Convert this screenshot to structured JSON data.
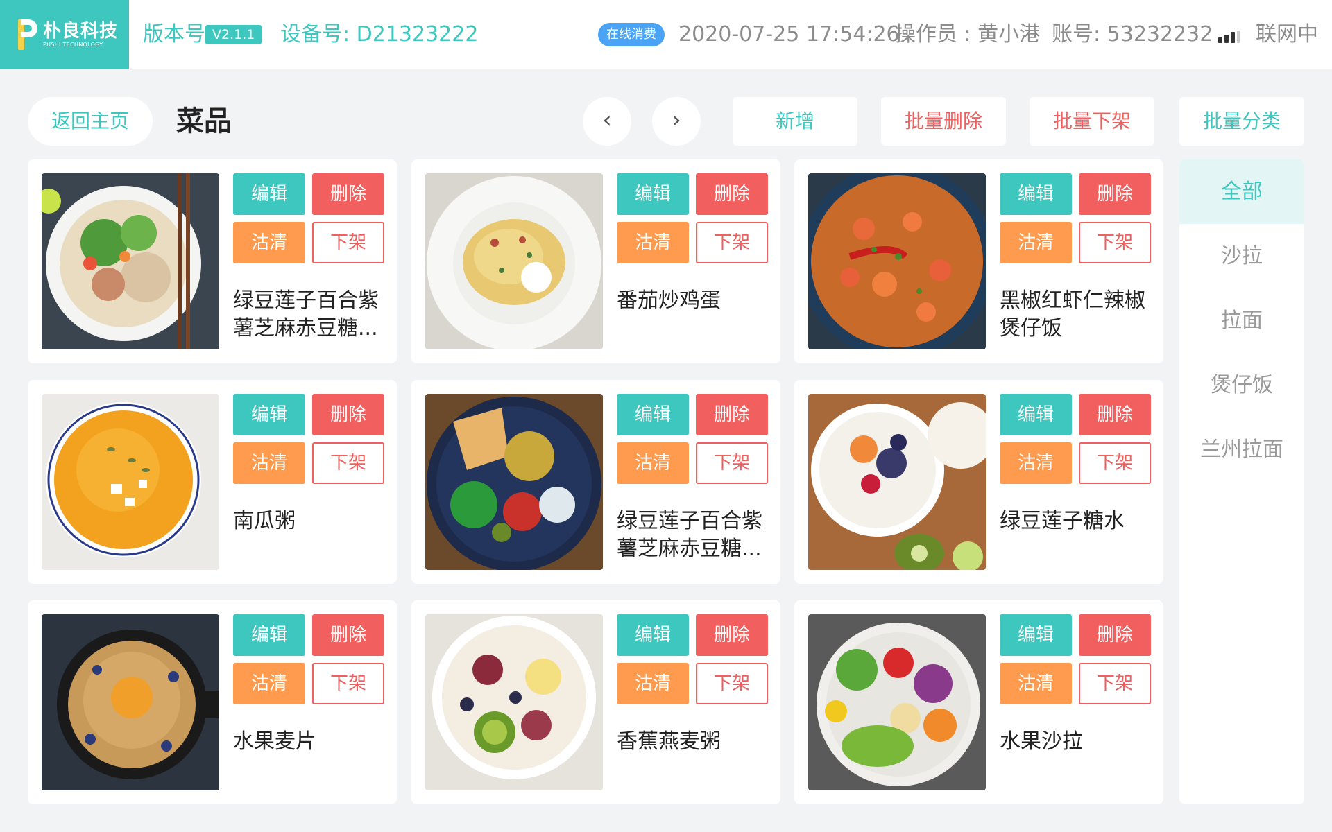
{
  "header": {
    "logo_name": "朴良科技",
    "logo_sub": "PUSHI TECHNOLOGY",
    "version_label": "版本号",
    "version_value": "V2.1.1",
    "device_label": "设备号: D21323222",
    "online_badge": "在线消费",
    "datetime": "2020-07-25 17:54:26",
    "operator": "操作员 : 黄小港",
    "account": "账号: 53232232",
    "network_status": "联网中"
  },
  "toolbar": {
    "back_label": "返回主页",
    "title": "菜品",
    "prev_icon": "‹",
    "next_icon": "›",
    "add_label": "新增",
    "batch_delete_label": "批量删除",
    "batch_offshelf_label": "批量下架",
    "batch_category_label": "批量分类"
  },
  "actions": {
    "edit": "编辑",
    "delete": "删除",
    "clean": "沽清",
    "offshelf": "下架"
  },
  "dishes": [
    {
      "name": "绿豆莲子百合紫薯芝麻赤豆糖...",
      "image": "noodle-salad-bowl"
    },
    {
      "name": "番茄炒鸡蛋",
      "image": "spaghetti-plate"
    },
    {
      "name": "黑椒红虾仁辣椒煲仔饭",
      "image": "shrimp-fried-rice"
    },
    {
      "name": "南瓜粥",
      "image": "pumpkin-soup"
    },
    {
      "name": "绿豆莲子百合紫薯芝麻赤豆糖...",
      "image": "chickpea-salad"
    },
    {
      "name": "绿豆莲子糖水",
      "image": "fruit-yogurt-bowl"
    },
    {
      "name": "水果麦片",
      "image": "pancake-pan"
    },
    {
      "name": "香蕉燕麦粥",
      "image": "fig-kiwi-bowl"
    },
    {
      "name": "水果沙拉",
      "image": "vegetable-salad"
    }
  ],
  "categories": [
    "全部",
    "沙拉",
    "拉面",
    "煲仔饭",
    "兰州拉面"
  ],
  "colors": {
    "accent": "#3dc7be",
    "danger": "#f25f5f",
    "warning": "#ff9b4e",
    "info": "#4aa3f5"
  }
}
